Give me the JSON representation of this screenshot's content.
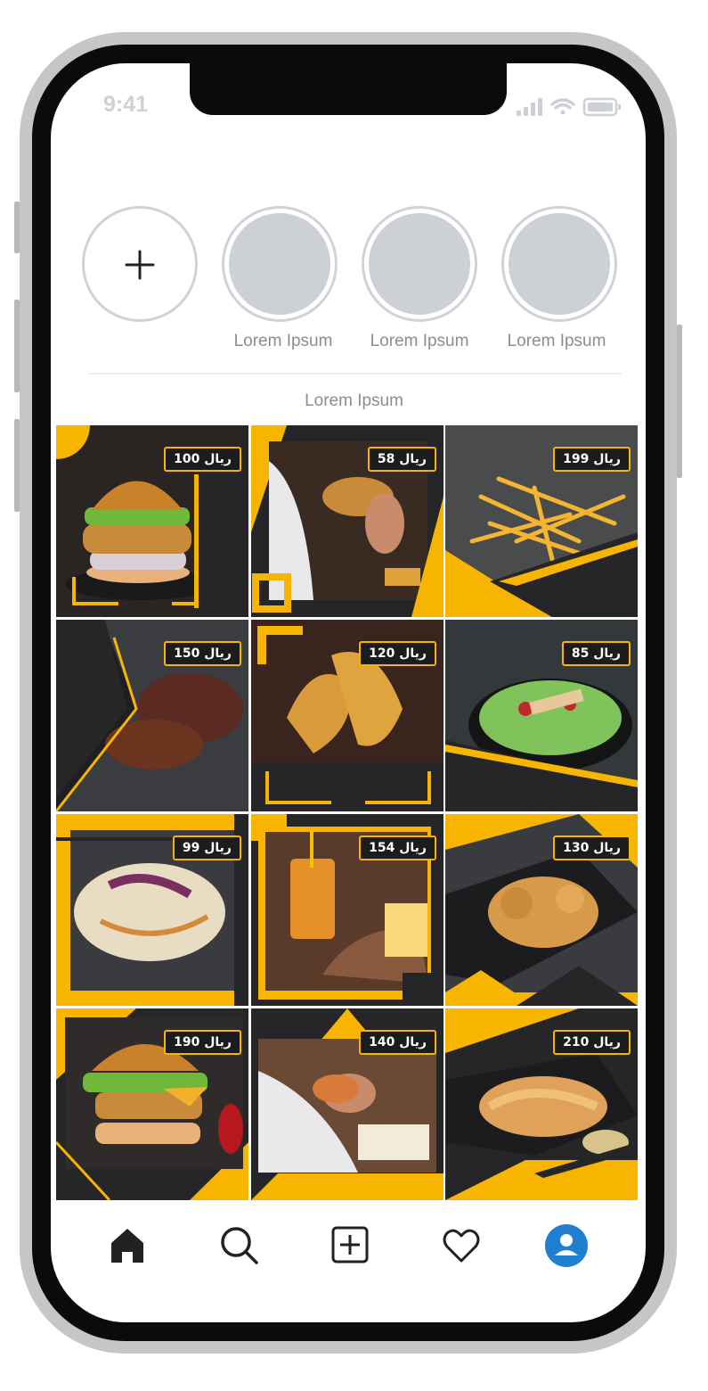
{
  "status_bar": {
    "time": "9:41"
  },
  "stories": {
    "labels": [
      "Lorem Ipsum",
      "Lorem Ipsum",
      "Lorem Ipsum"
    ]
  },
  "section_title": "Lorem Ipsum",
  "posts": [
    {
      "price": "100 ريال",
      "dish": "chicken-burger"
    },
    {
      "price": "58 ريال",
      "dish": "man-eating-sandwich"
    },
    {
      "price": "199 ريال",
      "dish": "french-fries"
    },
    {
      "price": "150 ريال",
      "dish": "beef-ribs"
    },
    {
      "price": "120 ريال",
      "dish": "chicken-strips"
    },
    {
      "price": "85 ريال",
      "dish": "salad-bowl"
    },
    {
      "price": "99 ريال",
      "dish": "coleslaw"
    },
    {
      "price": "154 ريال",
      "dish": "drink-and-fries"
    },
    {
      "price": "130 ريال",
      "dish": "fried-chicken-bites"
    },
    {
      "price": "190 ريال",
      "dish": "cheese-burger"
    },
    {
      "price": "140 ريال",
      "dish": "man-eating-wrap"
    },
    {
      "price": "210 ريال",
      "dish": "chicken-platter"
    }
  ],
  "colors": {
    "accent": "#f7b500",
    "dark": "#262528",
    "nav_profile": "#1f7fd0"
  },
  "nav": [
    "home-icon",
    "search-icon",
    "add-post-icon",
    "heart-icon",
    "profile-icon"
  ]
}
